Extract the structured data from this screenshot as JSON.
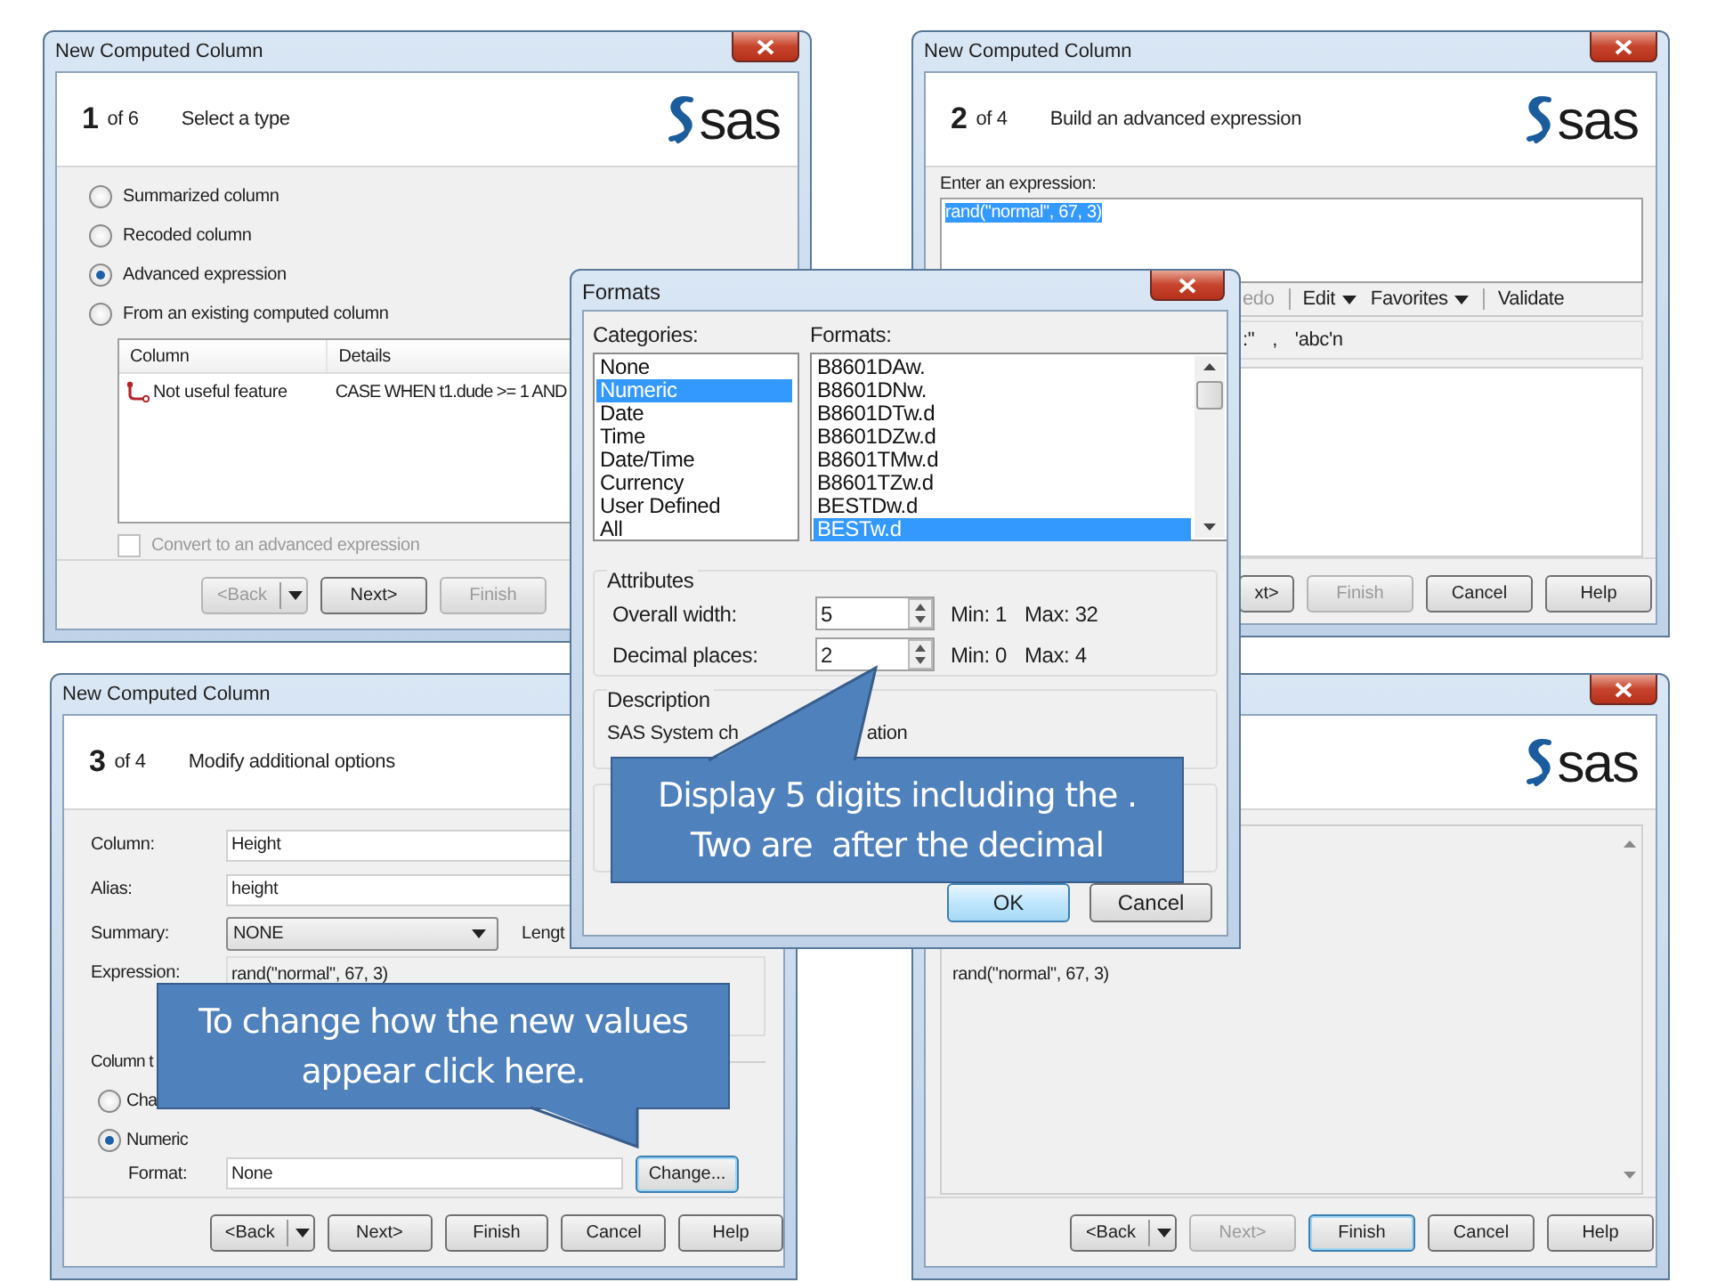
{
  "windows": [
    {
      "kind": "select_type",
      "title": "New Computed Column",
      "close_button": true,
      "step": "1",
      "step_of": "of 6",
      "heading": "Select a type",
      "logo": "sas",
      "options": [
        {
          "label": "Summarized column",
          "selected": false
        },
        {
          "label": "Recoded column",
          "selected": false
        },
        {
          "label": "Advanced expression",
          "selected": true
        },
        {
          "label": "From an existing computed column",
          "selected": false
        }
      ],
      "table": {
        "columns": [
          "Column",
          "Details"
        ],
        "rows": [
          {
            "column": "Not useful feature",
            "details": "CASE WHEN t1.dude >= 1 AND"
          }
        ]
      },
      "convert": {
        "label": "Convert to an advanced expression",
        "checked": false,
        "disabled": true
      },
      "buttons": [
        {
          "label": "<Back",
          "disabled": true,
          "focused": false,
          "dropdown": true
        },
        {
          "label": "Next>",
          "disabled": false,
          "focused": false,
          "dropdown": false
        },
        {
          "label": "Finish",
          "disabled": true,
          "focused": false,
          "dropdown": false
        }
      ]
    },
    {
      "kind": "expression",
      "title": "New Computed Column",
      "close_button": true,
      "step": "2",
      "step_of": "of 4",
      "heading": "Build an advanced expression",
      "logo": "sas",
      "expression_label": "Enter an expression:",
      "expression": "rand(\"normal\", 67, 3)",
      "expression_selected": true,
      "toolbar": [
        {
          "label": "edo",
          "menu": false,
          "disabled": true,
          "divider_before": false
        },
        {
          "label": "Edit",
          "menu": true,
          "disabled": false,
          "divider_before": true
        },
        {
          "label": "Favorites",
          "menu": true,
          "disabled": false,
          "divider_before": false
        },
        {
          "label": "Validate",
          "menu": false,
          "disabled": false,
          "divider_before": true
        }
      ],
      "operators": [
        ":\"",
        ",",
        "'abc'n"
      ],
      "buttons": [
        {
          "label": "xt>",
          "disabled": false,
          "focused": false,
          "dropdown": false
        },
        {
          "label": "Finish",
          "disabled": true,
          "focused": false,
          "dropdown": false
        },
        {
          "label": "Cancel",
          "disabled": false,
          "focused": false,
          "dropdown": false
        },
        {
          "label": "Help",
          "disabled": false,
          "focused": false,
          "dropdown": false
        }
      ]
    },
    {
      "kind": "options",
      "title": "New Computed Column",
      "step": "3",
      "step_of": "of 4",
      "heading": "Modify additional options",
      "fields": [
        {
          "kind": "text",
          "label": "Column:",
          "value": "Height"
        },
        {
          "kind": "text",
          "label": "Alias:",
          "value": "height"
        },
        {
          "kind": "select",
          "label": "Summary:",
          "value": "NONE",
          "aside": "Lengt"
        },
        {
          "kind": "static",
          "label": "Expression:",
          "value": "rand(\"normal\", 67, 3)"
        }
      ],
      "column_type_label": "Column t",
      "types": [
        {
          "label": "Cha",
          "selected": false
        },
        {
          "label": "Numeric",
          "selected": true
        }
      ],
      "format": {
        "label": "Format:",
        "value": "None",
        "button": "Change...",
        "button_focused": true
      },
      "buttons": [
        {
          "label": "<Back",
          "disabled": false,
          "focused": false,
          "dropdown": true
        },
        {
          "label": "Next>",
          "disabled": false,
          "focused": false,
          "dropdown": false
        },
        {
          "label": "Finish",
          "disabled": false,
          "focused": false,
          "dropdown": false
        },
        {
          "label": "Cancel",
          "disabled": false,
          "focused": false,
          "dropdown": false
        },
        {
          "label": "Help",
          "disabled": false,
          "focused": false,
          "dropdown": false
        }
      ]
    },
    {
      "kind": "summary",
      "close_button": true,
      "logo": "sas",
      "text": "rand(\"normal\", 67, 3)",
      "buttons": [
        {
          "label": "<Back",
          "disabled": false,
          "focused": false,
          "dropdown": true
        },
        {
          "label": "Next>",
          "disabled": true,
          "focused": false,
          "dropdown": false
        },
        {
          "label": "Finish",
          "disabled": false,
          "focused": true,
          "dropdown": false
        },
        {
          "label": "Cancel",
          "disabled": false,
          "focused": false,
          "dropdown": false
        },
        {
          "label": "Help",
          "disabled": false,
          "focused": false,
          "dropdown": false
        }
      ]
    }
  ],
  "formats_dialog": {
    "title": "Formats",
    "categories_label": "Categories:",
    "categories": [
      {
        "label": "None",
        "selected": false
      },
      {
        "label": "Numeric",
        "selected": true
      },
      {
        "label": "Date",
        "selected": false
      },
      {
        "label": "Time",
        "selected": false
      },
      {
        "label": "Date/Time",
        "selected": false
      },
      {
        "label": "Currency",
        "selected": false
      },
      {
        "label": "User Defined",
        "selected": false
      },
      {
        "label": "All",
        "selected": false
      }
    ],
    "formats_label": "Formats:",
    "formats": [
      {
        "label": "B8601DAw.",
        "selected": false
      },
      {
        "label": "B8601DNw.",
        "selected": false
      },
      {
        "label": "B8601DTw.d",
        "selected": false
      },
      {
        "label": "B8601DZw.d",
        "selected": false
      },
      {
        "label": "B8601TMw.d",
        "selected": false
      },
      {
        "label": "B8601TZw.d",
        "selected": false
      },
      {
        "label": "BESTDw.d",
        "selected": false
      },
      {
        "label": "BESTw.d",
        "selected": true
      }
    ],
    "attributes": {
      "label": "Attributes",
      "rows": [
        {
          "label": "Overall width:",
          "value": "5",
          "min": "Min: 1",
          "max": "Max: 32"
        },
        {
          "label": "Decimal places:",
          "value": "2",
          "min": "Min: 0",
          "max": "Max: 4"
        }
      ]
    },
    "description": {
      "label": "Description",
      "text_parts": [
        "SAS System ch",
        "ation"
      ]
    },
    "buttons": [
      {
        "label": "OK",
        "default": true
      },
      {
        "label": "Cancel",
        "default": false
      }
    ]
  },
  "callouts": [
    {
      "lines": [
        "Display 5 digits including the .",
        "Two are  after the decimal"
      ]
    },
    {
      "lines": [
        "To change how the new values",
        "appear click here."
      ]
    }
  ]
}
